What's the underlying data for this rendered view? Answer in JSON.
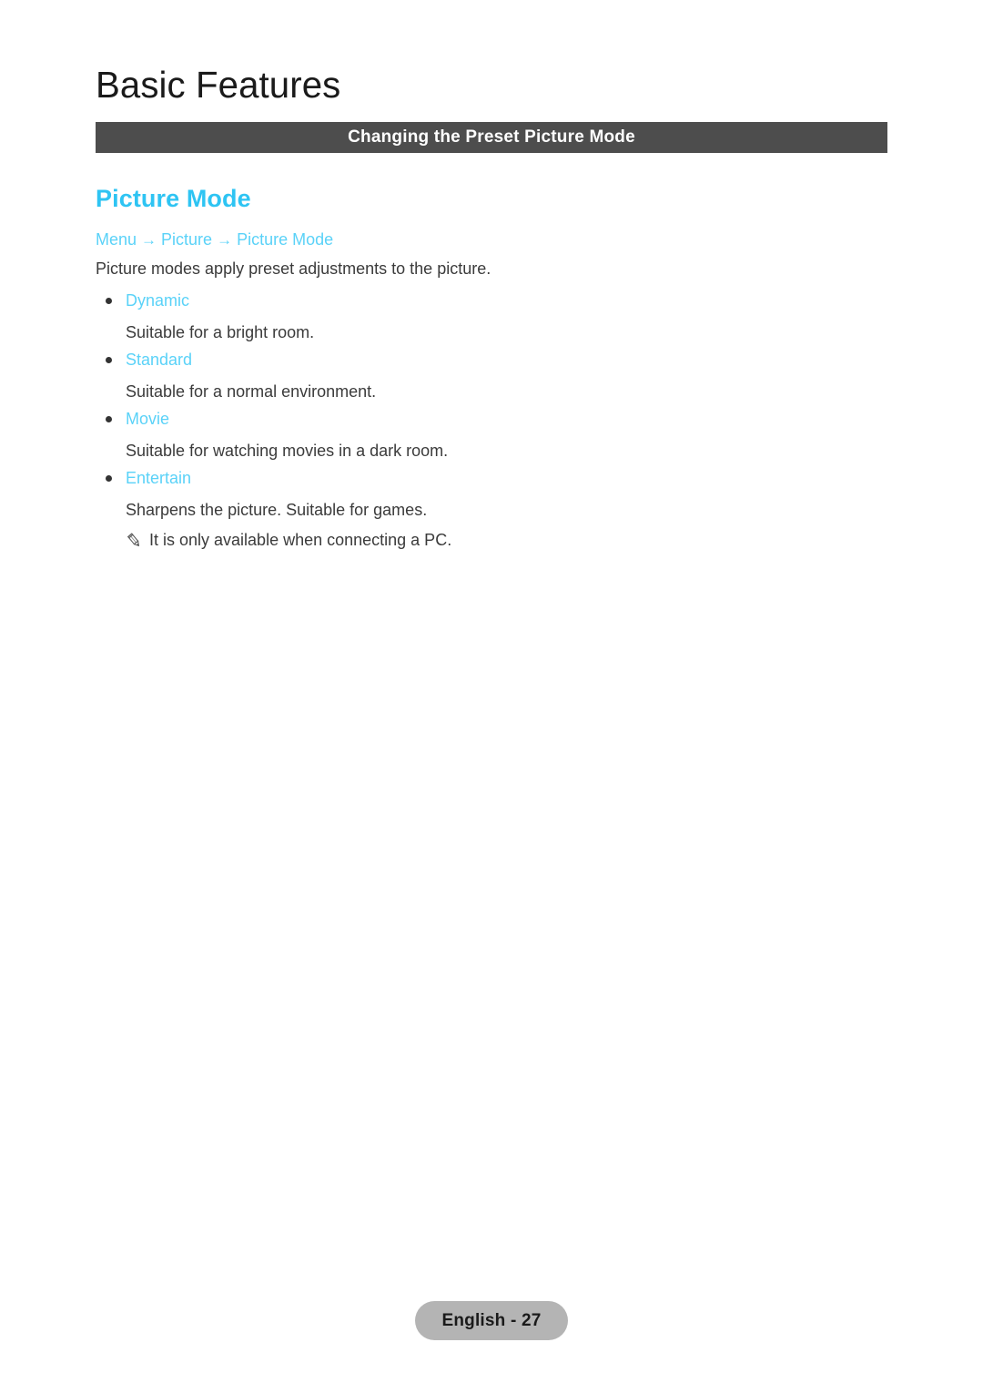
{
  "page": {
    "chapter_title": "Basic Features",
    "section_bar_label": "Changing the Preset Picture Mode",
    "main_heading": "Picture Mode",
    "intro_text": "Picture modes apply preset adjustments to the picture.",
    "accent_color": "#2ec4f3",
    "link_color": "#5ad2f8",
    "bar_color": "#4d4d4d",
    "body_color": "#3b3b3b",
    "badge_color": "#b4b4b4"
  },
  "breadcrumb": {
    "items": [
      "Menu",
      "Picture",
      "Picture Mode"
    ],
    "separator": "→"
  },
  "modes": [
    {
      "name": "Dynamic",
      "description": "Suitable for a bright room."
    },
    {
      "name": "Standard",
      "description": "Suitable for a normal environment."
    },
    {
      "name": "Movie",
      "description": "Suitable for watching movies in a dark room."
    },
    {
      "name": "Entertain",
      "description": "Sharpens the picture. Suitable for games.",
      "note": "It is only available when connecting a PC.",
      "note_icon": "pencil-note-icon"
    }
  ],
  "footer": {
    "page_label": "English - 27"
  }
}
